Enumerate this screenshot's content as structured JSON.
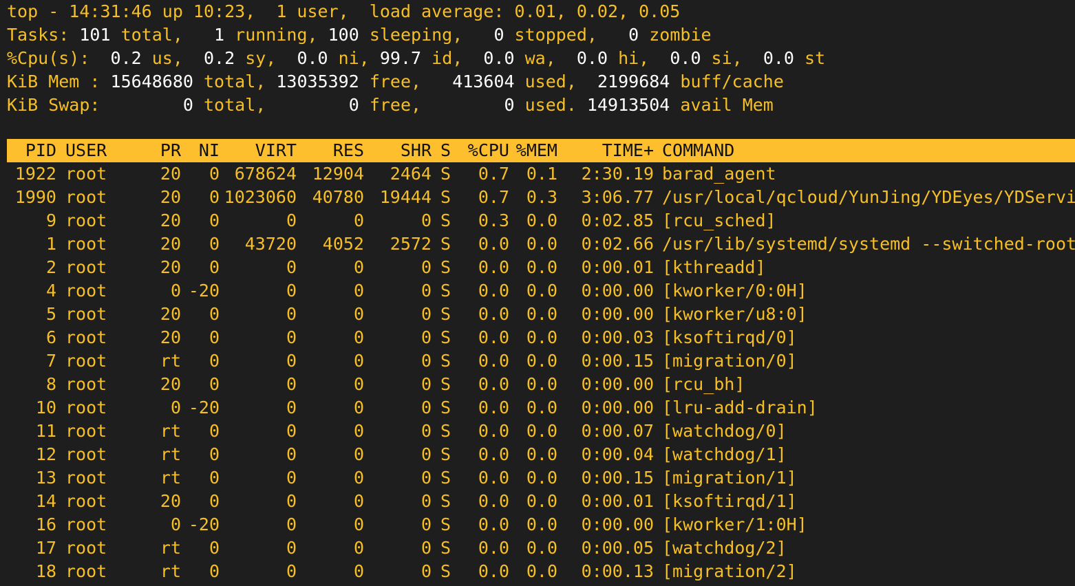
{
  "colors": {
    "background": "#1e1e1e",
    "text": "#f6bf26",
    "highlight": "#ffffff",
    "header_bar": "#fdbf2d",
    "header_text": "#111111"
  },
  "summary": {
    "line1": [
      {
        "t": "top - 14:31:46 up 10:23,  1 user,  load average: 0.01, 0.02, 0.05",
        "h": false
      }
    ],
    "line2": [
      {
        "t": "Tasks: ",
        "h": false
      },
      {
        "t": "101",
        "h": true
      },
      {
        "t": " total,   ",
        "h": false
      },
      {
        "t": "1",
        "h": true
      },
      {
        "t": " running, ",
        "h": false
      },
      {
        "t": "100",
        "h": true
      },
      {
        "t": " sleeping,   ",
        "h": false
      },
      {
        "t": "0",
        "h": true
      },
      {
        "t": " stopped,   ",
        "h": false
      },
      {
        "t": "0",
        "h": true
      },
      {
        "t": " zombie",
        "h": false
      }
    ],
    "line3": [
      {
        "t": "%Cpu(s):  ",
        "h": false
      },
      {
        "t": "0.2",
        "h": true
      },
      {
        "t": " us,  ",
        "h": false
      },
      {
        "t": "0.2",
        "h": true
      },
      {
        "t": " sy,  ",
        "h": false
      },
      {
        "t": "0.0",
        "h": true
      },
      {
        "t": " ni, ",
        "h": false
      },
      {
        "t": "99.7",
        "h": true
      },
      {
        "t": " id,  ",
        "h": false
      },
      {
        "t": "0.0",
        "h": true
      },
      {
        "t": " wa,  ",
        "h": false
      },
      {
        "t": "0.0",
        "h": true
      },
      {
        "t": " hi,  ",
        "h": false
      },
      {
        "t": "0.0",
        "h": true
      },
      {
        "t": " si,  ",
        "h": false
      },
      {
        "t": "0.0",
        "h": true
      },
      {
        "t": " st",
        "h": false
      }
    ],
    "line4": [
      {
        "t": "KiB Mem : ",
        "h": false
      },
      {
        "t": "15648680",
        "h": true
      },
      {
        "t": " total, ",
        "h": false
      },
      {
        "t": "13035392",
        "h": true
      },
      {
        "t": " free,   ",
        "h": false
      },
      {
        "t": "413604",
        "h": true
      },
      {
        "t": " used,  ",
        "h": false
      },
      {
        "t": "2199684",
        "h": true
      },
      {
        "t": " buff/cache",
        "h": false
      }
    ],
    "line5": [
      {
        "t": "KiB Swap:        ",
        "h": false
      },
      {
        "t": "0",
        "h": true
      },
      {
        "t": " total,        ",
        "h": false
      },
      {
        "t": "0",
        "h": true
      },
      {
        "t": " free,        ",
        "h": false
      },
      {
        "t": "0",
        "h": true
      },
      {
        "t": " used. ",
        "h": false
      },
      {
        "t": "14913504",
        "h": true
      },
      {
        "t": " avail Mem",
        "h": false
      }
    ]
  },
  "table": {
    "headers": {
      "pid": "PID",
      "user": "USER",
      "pr": "PR",
      "ni": "NI",
      "virt": "VIRT",
      "res": "RES",
      "shr": "SHR",
      "s": "S",
      "cpu": "%CPU",
      "mem": "%MEM",
      "time": "TIME+",
      "command": "COMMAND"
    },
    "rows": [
      {
        "pid": "1922",
        "user": "root",
        "pr": "20",
        "ni": "0",
        "virt": "678624",
        "res": "12904",
        "shr": "2464",
        "s": "S",
        "cpu": "0.7",
        "mem": "0.1",
        "time": "2:30.19",
        "command": "barad_agent"
      },
      {
        "pid": "1990",
        "user": "root",
        "pr": "20",
        "ni": "0",
        "virt": "1023060",
        "res": "40780",
        "shr": "19444",
        "s": "S",
        "cpu": "0.7",
        "mem": "0.3",
        "time": "3:06.77",
        "command": "/usr/local/qcloud/YunJing/YDEyes/YDService"
      },
      {
        "pid": "9",
        "user": "root",
        "pr": "20",
        "ni": "0",
        "virt": "0",
        "res": "0",
        "shr": "0",
        "s": "S",
        "cpu": "0.3",
        "mem": "0.0",
        "time": "0:02.85",
        "command": "[rcu_sched]"
      },
      {
        "pid": "1",
        "user": "root",
        "pr": "20",
        "ni": "0",
        "virt": "43720",
        "res": "4052",
        "shr": "2572",
        "s": "S",
        "cpu": "0.0",
        "mem": "0.0",
        "time": "0:02.66",
        "command": "/usr/lib/systemd/systemd --switched-root --"
      },
      {
        "pid": "2",
        "user": "root",
        "pr": "20",
        "ni": "0",
        "virt": "0",
        "res": "0",
        "shr": "0",
        "s": "S",
        "cpu": "0.0",
        "mem": "0.0",
        "time": "0:00.01",
        "command": "[kthreadd]"
      },
      {
        "pid": "4",
        "user": "root",
        "pr": "0",
        "ni": "-20",
        "virt": "0",
        "res": "0",
        "shr": "0",
        "s": "S",
        "cpu": "0.0",
        "mem": "0.0",
        "time": "0:00.00",
        "command": "[kworker/0:0H]"
      },
      {
        "pid": "5",
        "user": "root",
        "pr": "20",
        "ni": "0",
        "virt": "0",
        "res": "0",
        "shr": "0",
        "s": "S",
        "cpu": "0.0",
        "mem": "0.0",
        "time": "0:00.00",
        "command": "[kworker/u8:0]"
      },
      {
        "pid": "6",
        "user": "root",
        "pr": "20",
        "ni": "0",
        "virt": "0",
        "res": "0",
        "shr": "0",
        "s": "S",
        "cpu": "0.0",
        "mem": "0.0",
        "time": "0:00.03",
        "command": "[ksoftirqd/0]"
      },
      {
        "pid": "7",
        "user": "root",
        "pr": "rt",
        "ni": "0",
        "virt": "0",
        "res": "0",
        "shr": "0",
        "s": "S",
        "cpu": "0.0",
        "mem": "0.0",
        "time": "0:00.15",
        "command": "[migration/0]"
      },
      {
        "pid": "8",
        "user": "root",
        "pr": "20",
        "ni": "0",
        "virt": "0",
        "res": "0",
        "shr": "0",
        "s": "S",
        "cpu": "0.0",
        "mem": "0.0",
        "time": "0:00.00",
        "command": "[rcu_bh]"
      },
      {
        "pid": "10",
        "user": "root",
        "pr": "0",
        "ni": "-20",
        "virt": "0",
        "res": "0",
        "shr": "0",
        "s": "S",
        "cpu": "0.0",
        "mem": "0.0",
        "time": "0:00.00",
        "command": "[lru-add-drain]"
      },
      {
        "pid": "11",
        "user": "root",
        "pr": "rt",
        "ni": "0",
        "virt": "0",
        "res": "0",
        "shr": "0",
        "s": "S",
        "cpu": "0.0",
        "mem": "0.0",
        "time": "0:00.07",
        "command": "[watchdog/0]"
      },
      {
        "pid": "12",
        "user": "root",
        "pr": "rt",
        "ni": "0",
        "virt": "0",
        "res": "0",
        "shr": "0",
        "s": "S",
        "cpu": "0.0",
        "mem": "0.0",
        "time": "0:00.04",
        "command": "[watchdog/1]"
      },
      {
        "pid": "13",
        "user": "root",
        "pr": "rt",
        "ni": "0",
        "virt": "0",
        "res": "0",
        "shr": "0",
        "s": "S",
        "cpu": "0.0",
        "mem": "0.0",
        "time": "0:00.15",
        "command": "[migration/1]"
      },
      {
        "pid": "14",
        "user": "root",
        "pr": "20",
        "ni": "0",
        "virt": "0",
        "res": "0",
        "shr": "0",
        "s": "S",
        "cpu": "0.0",
        "mem": "0.0",
        "time": "0:00.01",
        "command": "[ksoftirqd/1]"
      },
      {
        "pid": "16",
        "user": "root",
        "pr": "0",
        "ni": "-20",
        "virt": "0",
        "res": "0",
        "shr": "0",
        "s": "S",
        "cpu": "0.0",
        "mem": "0.0",
        "time": "0:00.00",
        "command": "[kworker/1:0H]"
      },
      {
        "pid": "17",
        "user": "root",
        "pr": "rt",
        "ni": "0",
        "virt": "0",
        "res": "0",
        "shr": "0",
        "s": "S",
        "cpu": "0.0",
        "mem": "0.0",
        "time": "0:00.05",
        "command": "[watchdog/2]"
      },
      {
        "pid": "18",
        "user": "root",
        "pr": "rt",
        "ni": "0",
        "virt": "0",
        "res": "0",
        "shr": "0",
        "s": "S",
        "cpu": "0.0",
        "mem": "0.0",
        "time": "0:00.13",
        "command": "[migration/2]"
      }
    ]
  }
}
